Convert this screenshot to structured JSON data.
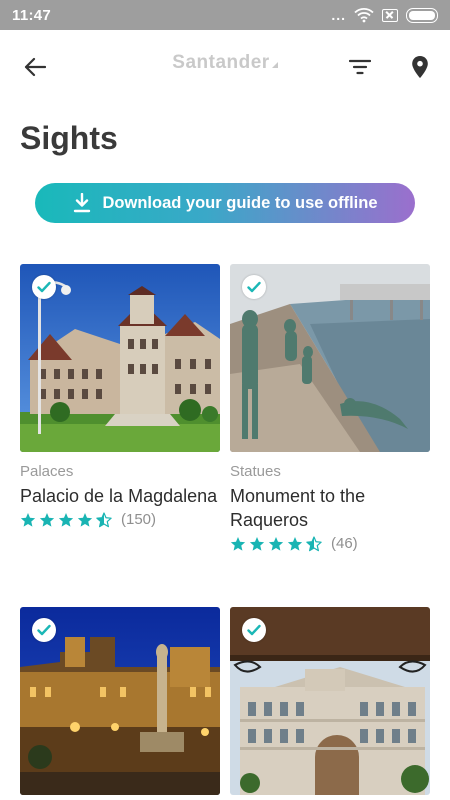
{
  "status_bar": {
    "time": "11:47",
    "dots": "..."
  },
  "header": {
    "logo_text": "Santander"
  },
  "page": {
    "title": "Sights"
  },
  "download": {
    "label": "Download your guide to use offline"
  },
  "colors": {
    "accent": "#1bb7b6",
    "gradient_start": "#19b9ba",
    "gradient_end": "#9b6fcd",
    "star": "#19b4b3"
  },
  "cards": [
    {
      "category": "Palaces",
      "title": "Palacio de la Magdalena",
      "rating": 4.5,
      "review_count": "(150)",
      "saved": true
    },
    {
      "category": "Statues",
      "title": "Monument to the Raqueros",
      "rating": 4.5,
      "review_count": "(46)",
      "saved": true
    },
    {
      "category": "",
      "title": "",
      "rating": null,
      "review_count": "",
      "saved": true
    },
    {
      "category": "",
      "title": "",
      "rating": null,
      "review_count": "",
      "saved": true
    }
  ]
}
